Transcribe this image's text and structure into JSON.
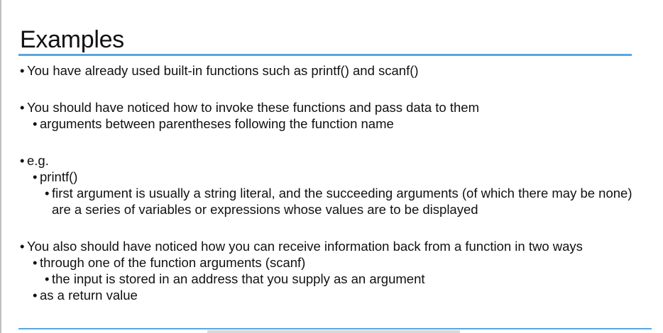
{
  "slide": {
    "title": "Examples",
    "bullets": {
      "b1": "You have already used built-in functions such as printf() and scanf()",
      "b2": "You should have noticed how to invoke these functions and pass data to them",
      "b2_1": "arguments between parentheses following the function name",
      "b3": "e.g.",
      "b3_1": "printf()",
      "b3_1_1": "first argument is usually a string literal, and the succeeding arguments (of which there may be none) are a series of variables or expressions whose values are to be displayed",
      "b4": "You also should have noticed how you can receive information back from a function in two ways",
      "b4_1": "through one of the function arguments (scanf)",
      "b4_1_1": "the input is stored in an address that you supply as an argument",
      "b4_2": "as a return value"
    }
  },
  "colors": {
    "accent": "#5aa6df",
    "text": "#111111",
    "background": "#ffffff"
  }
}
